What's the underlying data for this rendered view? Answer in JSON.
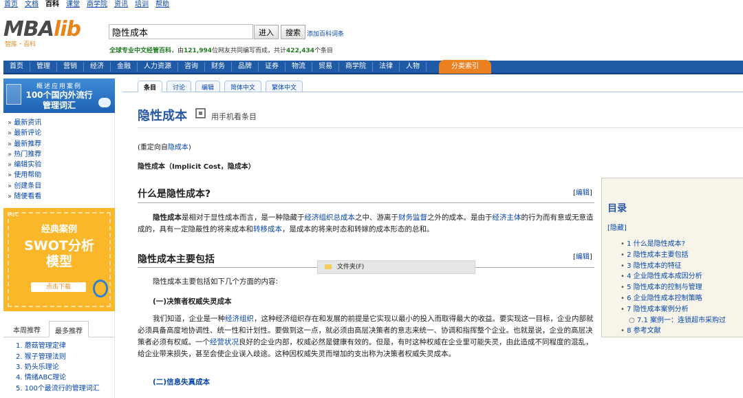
{
  "topnav": {
    "items": [
      "首页",
      "文档",
      "百科",
      "课堂",
      "商学院",
      "资讯",
      "培训",
      "帮助"
    ],
    "active": 2
  },
  "logo": {
    "word_main": "MBA",
    "word_lib": "lib",
    "subtitle": "智库・百科"
  },
  "search": {
    "value": "隐性成本",
    "enter_label": "进入",
    "search_label": "搜索",
    "add_entry": "添加百科词条"
  },
  "stats": {
    "lead": "全球专业中文经管百科",
    "mid": "，由",
    "users": "121,994",
    "mid2": "位网友共同编写而成，共计",
    "entries": "422,434",
    "tail": "个条目"
  },
  "categories": [
    "首页",
    "管理",
    "营销",
    "经济",
    "金融",
    "人力资源",
    "咨询",
    "财务",
    "品牌",
    "证券",
    "物流",
    "贸易",
    "商学院",
    "法律",
    "人物"
  ],
  "case_index_label": "分类索引",
  "sidebar": {
    "banner1": {
      "line1": "概述应用案例",
      "line2": "100个国内外流行",
      "line3": "管理词汇"
    },
    "quick_links": [
      "最新资讯",
      "最新评论",
      "最新推荐",
      "热门推荐",
      "编辑实验",
      "使用帮助",
      "创建条目",
      "随便看看"
    ],
    "banner2": {
      "tag": "REC",
      "line1": "经典案例",
      "line2": "SWOT分析",
      "line3": "模型",
      "download": "点击下载"
    },
    "tabs": [
      "本周推荐",
      "最多推荐"
    ],
    "top_list": [
      "1. 蘑菇管理定律",
      "2. 猴子管理法则",
      "3. 奶头乐理论",
      "4. 情绪ABC理论",
      "5. 100个最流行的管理词汇"
    ]
  },
  "content_tabs": [
    "条目",
    "讨论",
    "编辑",
    "简体中文",
    "繁体中文"
  ],
  "page": {
    "title": "隐性成本",
    "mobile_view": "用手机看条目",
    "redirect_prefix": "(重定向自",
    "redirect_link": "隐成本",
    "redirect_suffix": ")",
    "alias": "隐性成本（Implicit Cost，隐成本）"
  },
  "sections": [
    {
      "heading": "什么是隐性成本?",
      "edit": "编辑"
    },
    {
      "heading": "隐性成本主要包括",
      "edit": "编辑"
    }
  ],
  "para1": {
    "bold": "隐性成本",
    "t1": "是相对于显性成本而言，是一种隐藏于",
    "l1": "经济组织总成本",
    "t2": "之中、游离于",
    "l2": "财务监督",
    "t3": "之外的成本。是由于",
    "l3": "经济主体",
    "t4": "的行为而有意或无意造成的，具有一定隐蔽性的将来成本和",
    "l4": "转移成本",
    "t5": "，是成本的将来时态和转嫁的成本形态的总和。"
  },
  "para2_intro": "隐性成本主要包括如下几个方面的内容:",
  "sub1": "(一)决策者权威失灵成本",
  "para3": {
    "t1": "我们知道，企业是一种",
    "l1": "经济组织",
    "t2": "，这种经济组织存在和发展的前提是它实现以最小的投入而取得最大的收益。要实现这一目标，企业内部就必须具备高度地协调性、统一性和计划性。要做到这一点，就必须由高层决策者的意志来统一、协调和指挥整个企业。也就是说，企业的高层决策者必须有权威。一个",
    "l2": "经营状况",
    "t3": "良好的企业内部，权威必然是健康有效的。但是，有时这种权威在企业里可能失灵，由此造成不同程度的混乱，给企业带来损失，甚至会使企业误入歧途。这种因权威失灵而增加的支出称为决策者权威失灵成本。"
  },
  "sub2_prefix": "(二)",
  "sub2_link": "信息失真成本",
  "context_menu": {
    "item": "文件夹(F)"
  },
  "toc": {
    "title": "目录",
    "hide": "[隐藏]",
    "items": [
      "1 什么是隐性成本?",
      "2 隐性成本主要包括",
      "3 隐性成本的特征",
      "4 企业隐性成本成因分析",
      "5 隐性成本的控制与管理",
      "6 企业隐性成本控制策略",
      "7 隐性成本案例分析",
      "7.1 案例一：连锁超市采购过",
      "8 参考文献"
    ]
  }
}
